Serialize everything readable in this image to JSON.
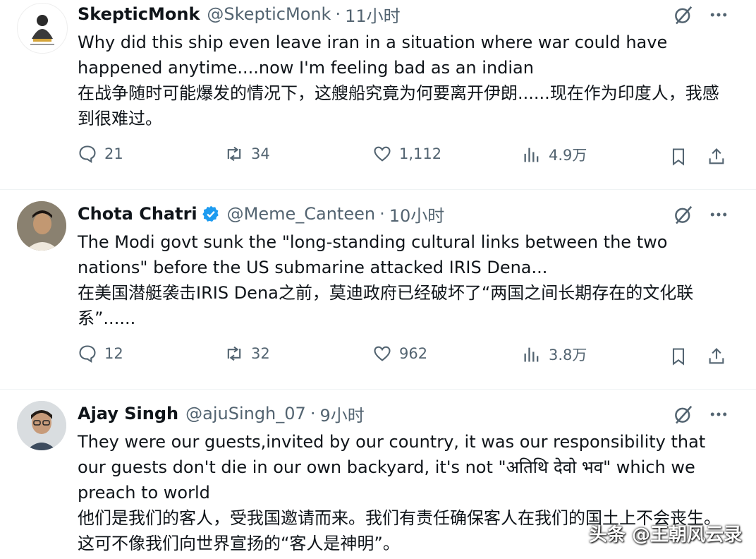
{
  "tweets": [
    {
      "name": "SkepticMonk",
      "verified": false,
      "handle": "@SkepticMonk",
      "dot": "·",
      "time": "11小时",
      "text_en": "Why did this ship even leave iran in a situation where war could have happened anytime....now I'm feeling bad as an indian",
      "text_zh": "在战争随时可能爆发的情况下，这艘船究竟为何要离开伊朗......现在作为印度人，我感到很难过。",
      "replies": "21",
      "reposts": "34",
      "likes": "1,112",
      "views": "4.9万"
    },
    {
      "name": "Chota Chatri",
      "verified": true,
      "handle": "@Meme_Canteen",
      "dot": "·",
      "time": "10小时",
      "text_en": "The Modi govt sunk the \"long-standing cultural links between the two nations\" before the US submarine attacked IRIS Dena...",
      "text_zh": "在美国潜艇袭击IRIS Dena之前，莫迪政府已经破坏了“两国之间长期存在的文化联系”......",
      "replies": "12",
      "reposts": "32",
      "likes": "962",
      "views": "3.8万"
    },
    {
      "name": "Ajay Singh",
      "verified": false,
      "handle": "@ajuSingh_07",
      "dot": "·",
      "time": "9小时",
      "text_en": "They were our guests,invited by our country, it was our responsibility that our guests don't die in our own backyard, it's not \"अतिथि देवो भव\" which we preach to world",
      "text_zh": "他们是我们的客人，受我国邀请而来。我们有责任确保客人在我们的国土上不会丧生。这可不像我们向世界宣扬的“客人是神明”。"
    }
  ],
  "watermark": "头条 @王朝风云录",
  "colors": {
    "text": "#0f1419",
    "muted": "#536471",
    "verified": "#1d9bf0",
    "divider": "#eff3f4"
  }
}
